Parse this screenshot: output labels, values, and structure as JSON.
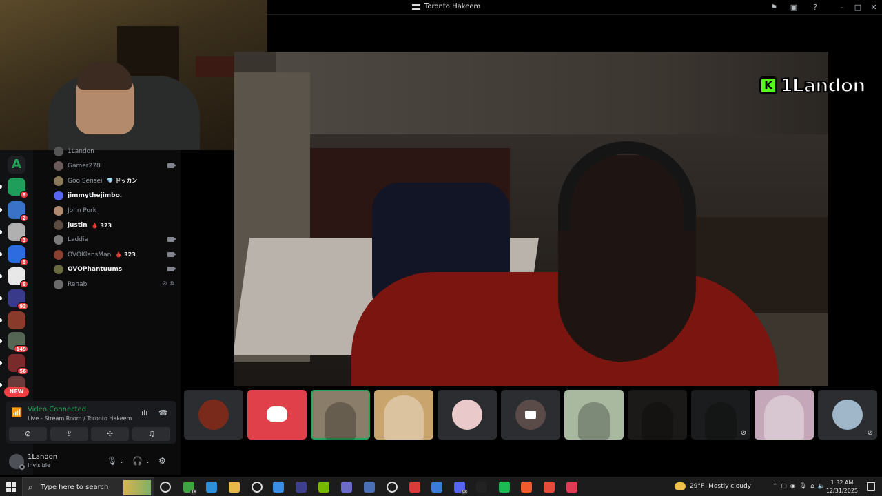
{
  "window": {
    "title": "Toronto Hakeem",
    "controls": [
      "flag-icon",
      "inbox-icon",
      "help-icon",
      "minimize-icon",
      "maximize-icon",
      "close-icon"
    ]
  },
  "stream_overlay": {
    "badge_letter": "K",
    "name": "1Landon"
  },
  "servers": [
    {
      "icon": "a-server-icon",
      "badge": ""
    },
    {
      "icon": "server-icon",
      "badge": "8"
    },
    {
      "icon": "server-icon",
      "badge": "2"
    },
    {
      "icon": "server-icon",
      "badge": "3"
    },
    {
      "icon": "server-icon",
      "badge": "8"
    },
    {
      "icon": "server-icon",
      "badge": "6"
    },
    {
      "icon": "server-icon",
      "badge": "93"
    },
    {
      "icon": "server-icon",
      "badge": ""
    },
    {
      "icon": "server-icon",
      "badge": "149"
    },
    {
      "icon": "server-icon",
      "badge": "56"
    },
    {
      "icon": "server-icon",
      "badge": ""
    }
  ],
  "server_letter": "A",
  "new_badge": "NEW",
  "members": [
    {
      "name": "1Landon",
      "bold": false,
      "tag": "",
      "cam": false,
      "muted": false
    },
    {
      "name": "Gamer278",
      "bold": false,
      "tag": "",
      "cam": true,
      "muted": false
    },
    {
      "name": "Goo Sensei",
      "bold": false,
      "tag": "💎 ドッカン",
      "cam": false,
      "muted": false
    },
    {
      "name": "jimmythejimbo.",
      "bold": true,
      "tag": "",
      "cam": false,
      "muted": false
    },
    {
      "name": "John Pork",
      "bold": false,
      "tag": "",
      "cam": false,
      "muted": false
    },
    {
      "name": "justin",
      "bold": true,
      "tag": "🩸 323",
      "cam": false,
      "muted": false
    },
    {
      "name": "Laddie",
      "bold": false,
      "tag": "",
      "cam": true,
      "muted": false
    },
    {
      "name": "OVOKlansMan",
      "bold": false,
      "tag": "🩸 323",
      "cam": true,
      "muted": false
    },
    {
      "name": "OVOPhantuums",
      "bold": true,
      "tag": "",
      "cam": true,
      "muted": false
    },
    {
      "name": "Rehab",
      "bold": false,
      "tag": "",
      "cam": false,
      "muted": true
    }
  ],
  "voice": {
    "status": "Video Connected",
    "location": "Live - Stream Room / Toronto Hakeem",
    "buttons": [
      "camera-off-icon",
      "screen-share-icon",
      "activities-icon",
      "soundboard-icon"
    ]
  },
  "user": {
    "name": "1Landon",
    "status": "Invisible"
  },
  "tiles": [
    {
      "kind": "avatar",
      "color": "#7a2a1a",
      "muted": false,
      "speaking": false
    },
    {
      "kind": "discord",
      "color": "#e0404a",
      "muted": false,
      "speaking": false
    },
    {
      "kind": "video",
      "color": "#8a7d6a",
      "muted": false,
      "speaking": true
    },
    {
      "kind": "avatar-square",
      "color": "#c9a46c",
      "muted": false,
      "speaking": false
    },
    {
      "kind": "avatar",
      "color": "#e9c9c9",
      "muted": false,
      "speaking": false
    },
    {
      "kind": "camera",
      "color": "#5a4a48",
      "muted": false,
      "speaking": false
    },
    {
      "kind": "video",
      "color": "#a9b9a0",
      "muted": false,
      "speaking": false
    },
    {
      "kind": "video",
      "color": "#1c1a18",
      "muted": false,
      "speaking": false
    },
    {
      "kind": "video",
      "color": "#1b1c1d",
      "muted": true,
      "speaking": false
    },
    {
      "kind": "avatar-square",
      "color": "#c4a8b9",
      "muted": false,
      "speaking": false
    },
    {
      "kind": "avatar",
      "color": "#9fb7c9",
      "muted": true,
      "speaking": false
    }
  ],
  "taskbar": {
    "search_placeholder": "Type here to search",
    "apps": [
      {
        "icon": "task-view-icon",
        "color": "#dddddd",
        "count": ""
      },
      {
        "icon": "xbox-icon",
        "color": "#3fa33f",
        "count": "18"
      },
      {
        "icon": "edge-icon",
        "color": "#2f8fd8",
        "count": ""
      },
      {
        "icon": "file-explorer-icon",
        "color": "#e8b84a",
        "count": ""
      },
      {
        "icon": "obs-icon",
        "color": "#dddddd",
        "count": ""
      },
      {
        "icon": "store-icon",
        "color": "#3a8ee6",
        "count": ""
      },
      {
        "icon": "app-icon",
        "color": "#3d3f8a",
        "count": ""
      },
      {
        "icon": "nvidia-icon",
        "color": "#76b900",
        "count": ""
      },
      {
        "icon": "media-icon",
        "color": "#6c6cc8",
        "count": ""
      },
      {
        "icon": "calculator-icon",
        "color": "#4a6fb5",
        "count": ""
      },
      {
        "icon": "settings-icon",
        "color": "#dddddd",
        "count": ""
      },
      {
        "icon": "roblox-icon",
        "color": "#d93a3a",
        "count": ""
      },
      {
        "icon": "app-icon",
        "color": "#3a7bd5",
        "count": ""
      },
      {
        "icon": "discord-icon",
        "color": "#5865f2",
        "count": "98"
      },
      {
        "icon": "app-icon",
        "color": "#222222",
        "count": ""
      },
      {
        "icon": "spotify-icon",
        "color": "#1db954",
        "count": ""
      },
      {
        "icon": "brave-icon",
        "color": "#f05b2d",
        "count": ""
      },
      {
        "icon": "chrome-icon",
        "color": "#e54b3b",
        "count": ""
      },
      {
        "icon": "app-icon",
        "color": "#e03a55",
        "count": ""
      }
    ],
    "weather": {
      "temp": "29°F",
      "condition": "Mostly cloudy"
    },
    "time": "1:32 AM",
    "date": "12/31/2025"
  }
}
